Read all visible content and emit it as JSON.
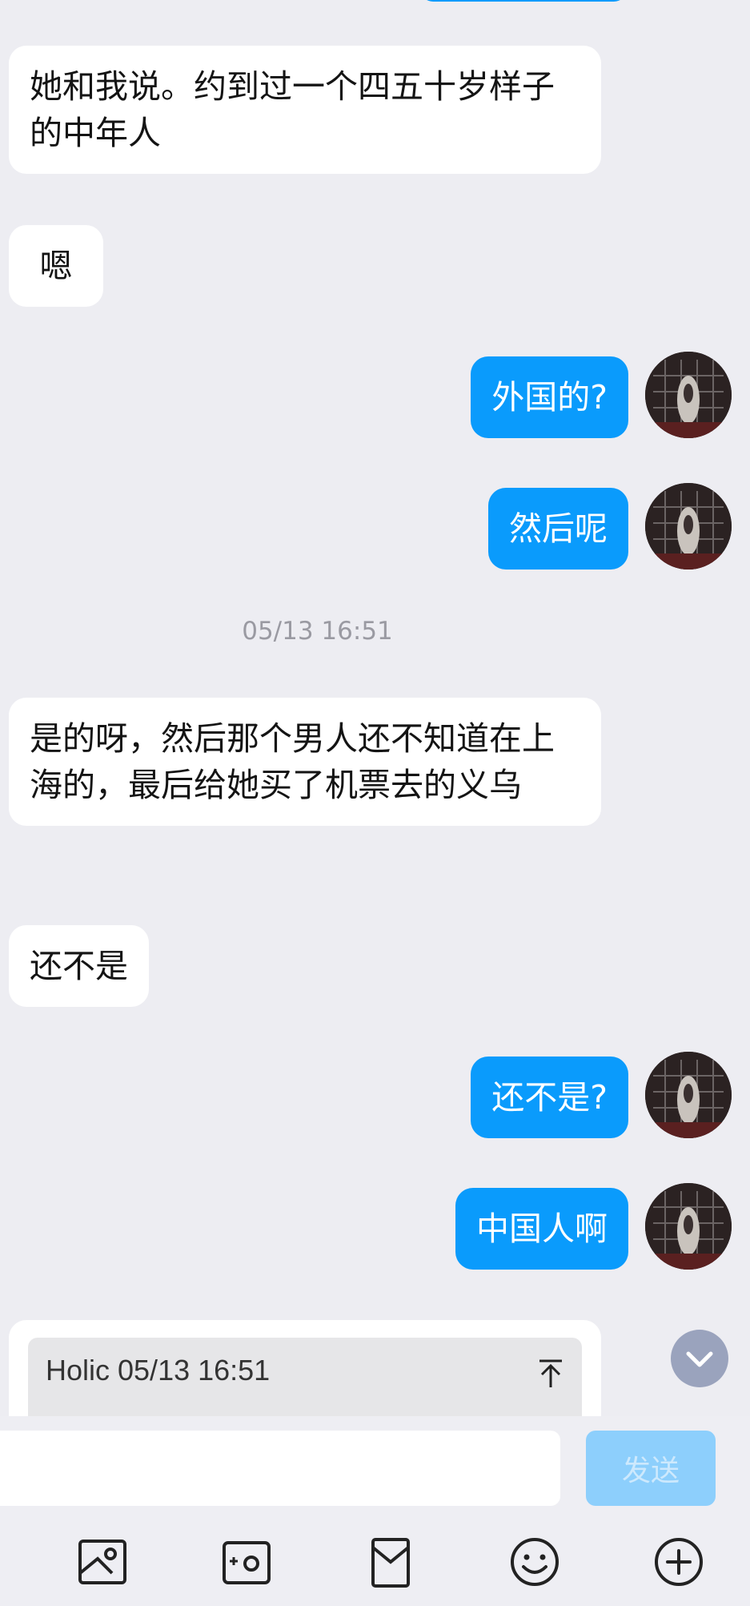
{
  "messages": [
    {
      "side": "in",
      "text": "她和我说。约到过一个四五十岁样子的中年人"
    },
    {
      "side": "in",
      "text": "嗯"
    },
    {
      "side": "out",
      "text": "外国的?"
    },
    {
      "side": "out",
      "text": "然后呢"
    },
    {
      "side": "in",
      "text": "是的呀，然后那个男人还不知道在上海的，最后给她买了机票去的义乌"
    },
    {
      "side": "in",
      "text": "还不是"
    },
    {
      "side": "out",
      "text": "还不是?"
    },
    {
      "side": "out",
      "text": "中国人啊"
    }
  ],
  "timestamp": "05/13 16:51",
  "quote": {
    "text": "Holic 05/13 16:51"
  },
  "input": {
    "value": "",
    "send_label": "发送"
  },
  "toolbar": [
    "image-icon",
    "camera-icon",
    "red-packet-icon",
    "emoji-icon",
    "plus-icon"
  ],
  "colors": {
    "accent": "#0a9bfc",
    "background": "#ededf2",
    "send_disabled": "#8dcffc"
  }
}
